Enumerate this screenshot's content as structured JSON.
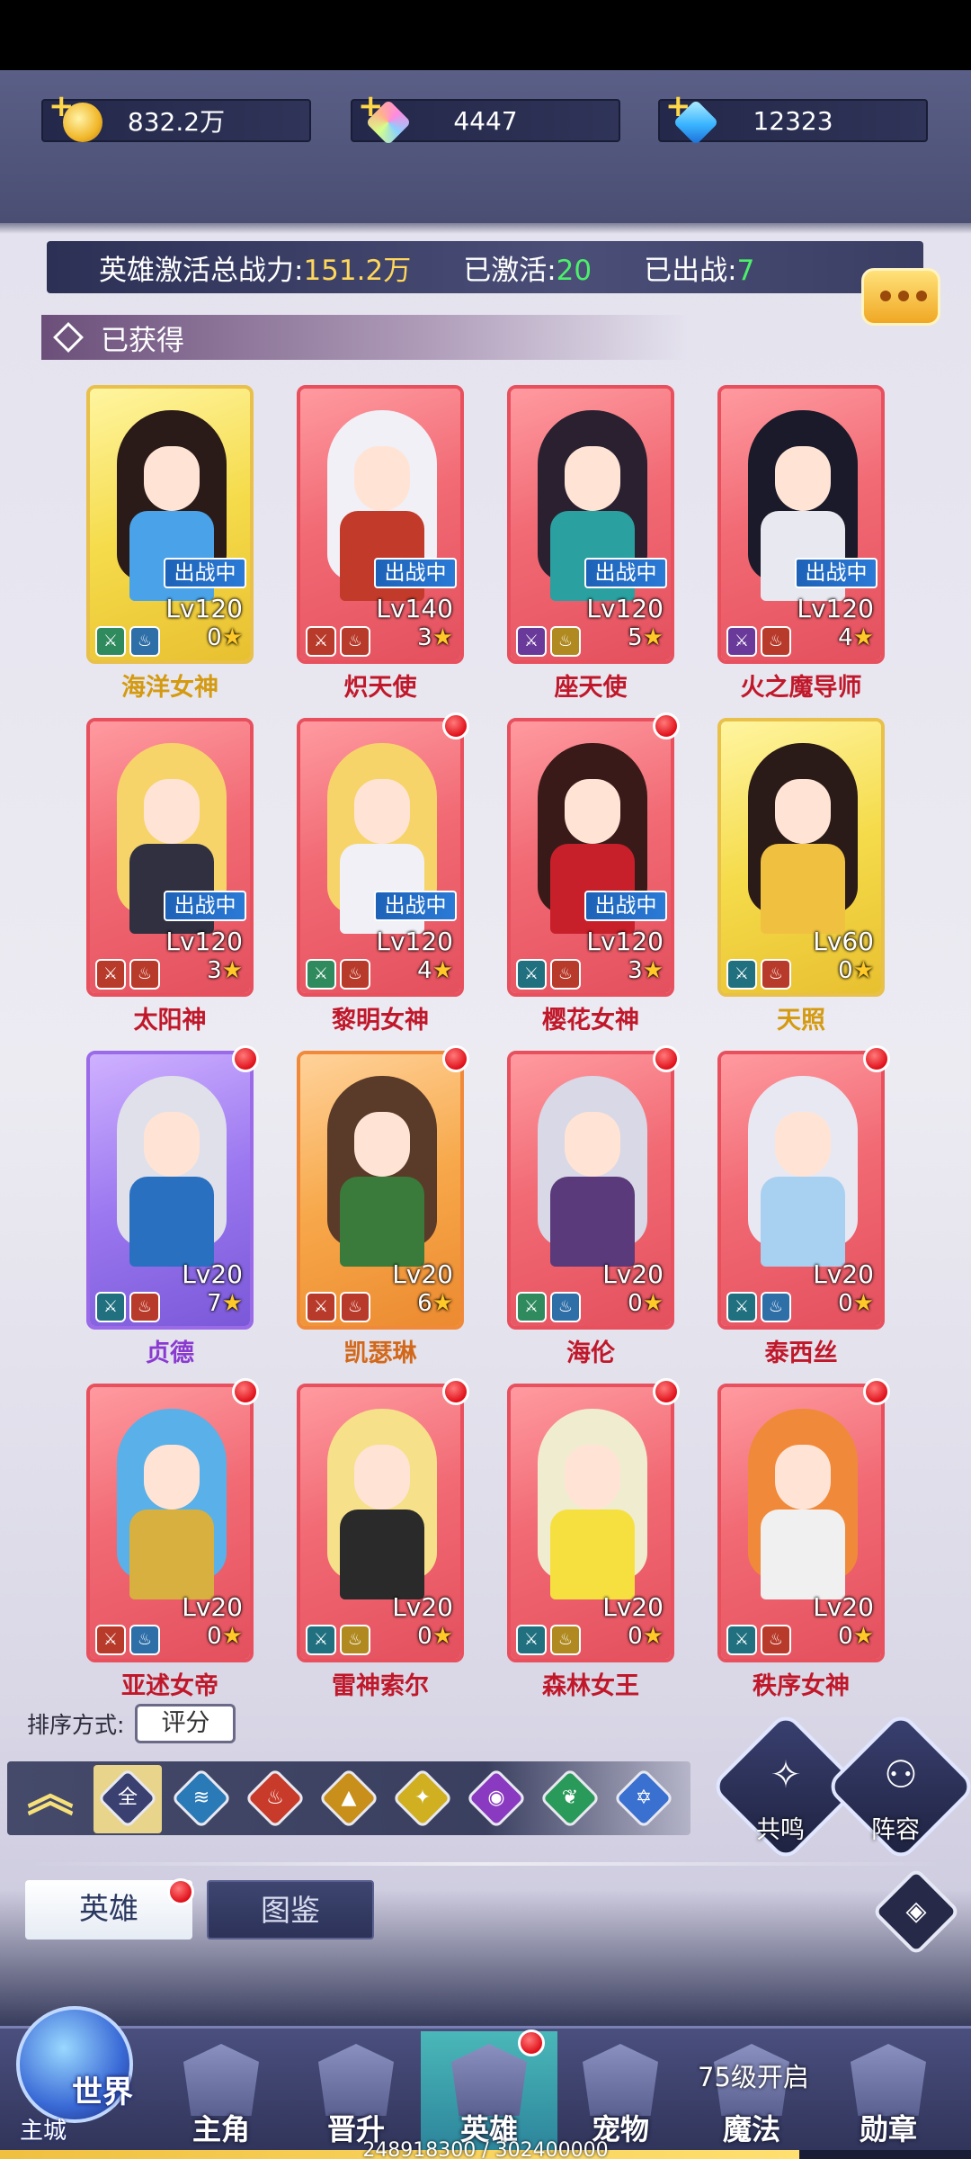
{
  "resources": [
    {
      "icon": "gold-coin-icon",
      "value": "832.2万"
    },
    {
      "icon": "rainbow-crystal-icon",
      "value": "4447"
    },
    {
      "icon": "blue-diamond-icon",
      "value": "12323"
    }
  ],
  "power": {
    "label": "英雄激活总战力:",
    "value": "151.2万",
    "activated_label": "已激活:",
    "activated_value": "20",
    "deployed_label": "已出战:",
    "deployed_value": "7"
  },
  "section_title": "已获得",
  "battle_badge": "出战中",
  "heroes": [
    {
      "name": "海洋女神",
      "level": "Lv120",
      "stars": "0",
      "in_battle": true,
      "red_dot": false,
      "frame": "gold"
    },
    {
      "name": "炽天使",
      "level": "Lv140",
      "stars": "3",
      "in_battle": true,
      "red_dot": false,
      "frame": "red"
    },
    {
      "name": "座天使",
      "level": "Lv120",
      "stars": "5",
      "in_battle": true,
      "red_dot": false,
      "frame": "red"
    },
    {
      "name": "火之魔导师",
      "level": "Lv120",
      "stars": "4",
      "in_battle": true,
      "red_dot": false,
      "frame": "red"
    },
    {
      "name": "太阳神",
      "level": "Lv120",
      "stars": "3",
      "in_battle": true,
      "red_dot": false,
      "frame": "red"
    },
    {
      "name": "黎明女神",
      "level": "Lv120",
      "stars": "4",
      "in_battle": true,
      "red_dot": true,
      "frame": "red"
    },
    {
      "name": "樱花女神",
      "level": "Lv120",
      "stars": "3",
      "in_battle": true,
      "red_dot": true,
      "frame": "red"
    },
    {
      "name": "天照",
      "level": "Lv60",
      "stars": "0",
      "in_battle": false,
      "red_dot": false,
      "frame": "gold"
    },
    {
      "name": "贞德",
      "level": "Lv20",
      "stars": "7",
      "in_battle": false,
      "red_dot": true,
      "frame": "purple"
    },
    {
      "name": "凯瑟琳",
      "level": "Lv20",
      "stars": "6",
      "in_battle": false,
      "red_dot": true,
      "frame": "orange"
    },
    {
      "name": "海伦",
      "level": "Lv20",
      "stars": "0",
      "in_battle": false,
      "red_dot": true,
      "frame": "red"
    },
    {
      "name": "泰西丝",
      "level": "Lv20",
      "stars": "0",
      "in_battle": false,
      "red_dot": true,
      "frame": "red"
    },
    {
      "name": "亚述女帝",
      "level": "Lv20",
      "stars": "0",
      "in_battle": false,
      "red_dot": true,
      "frame": "red"
    },
    {
      "name": "雷神索尔",
      "level": "Lv20",
      "stars": "0",
      "in_battle": false,
      "red_dot": true,
      "frame": "red"
    },
    {
      "name": "森林女王",
      "level": "Lv20",
      "stars": "0",
      "in_battle": false,
      "red_dot": true,
      "frame": "red"
    },
    {
      "name": "秩序女神",
      "level": "Lv20",
      "stars": "0",
      "in_battle": false,
      "red_dot": true,
      "frame": "red"
    }
  ],
  "sort": {
    "label": "排序方式:",
    "value": "评分"
  },
  "filters": [
    {
      "icon": "all-icon",
      "glyph": "全"
    },
    {
      "icon": "water-element-icon",
      "glyph": "≋"
    },
    {
      "icon": "fire-element-icon",
      "glyph": "♨"
    },
    {
      "icon": "earth-element-icon",
      "glyph": "▲"
    },
    {
      "icon": "light-element-icon",
      "glyph": "✦"
    },
    {
      "icon": "dark-element-icon",
      "glyph": "◉"
    },
    {
      "icon": "wind-element-icon",
      "glyph": "❦"
    },
    {
      "icon": "star-element-icon",
      "glyph": "✡"
    }
  ],
  "actions": {
    "resonance": "共鸣",
    "lineup": "阵容"
  },
  "tabs": {
    "hero": "英雄",
    "atlas": "图鉴"
  },
  "nav": {
    "world": "世界",
    "main_city": "主城",
    "items": [
      "主角",
      "晋升",
      "英雄",
      "宠物",
      "魔法",
      "勋章"
    ],
    "magic_lock": "75级开启"
  },
  "xp": {
    "text": "248918300 / 302400000",
    "fraction": 0.823
  }
}
